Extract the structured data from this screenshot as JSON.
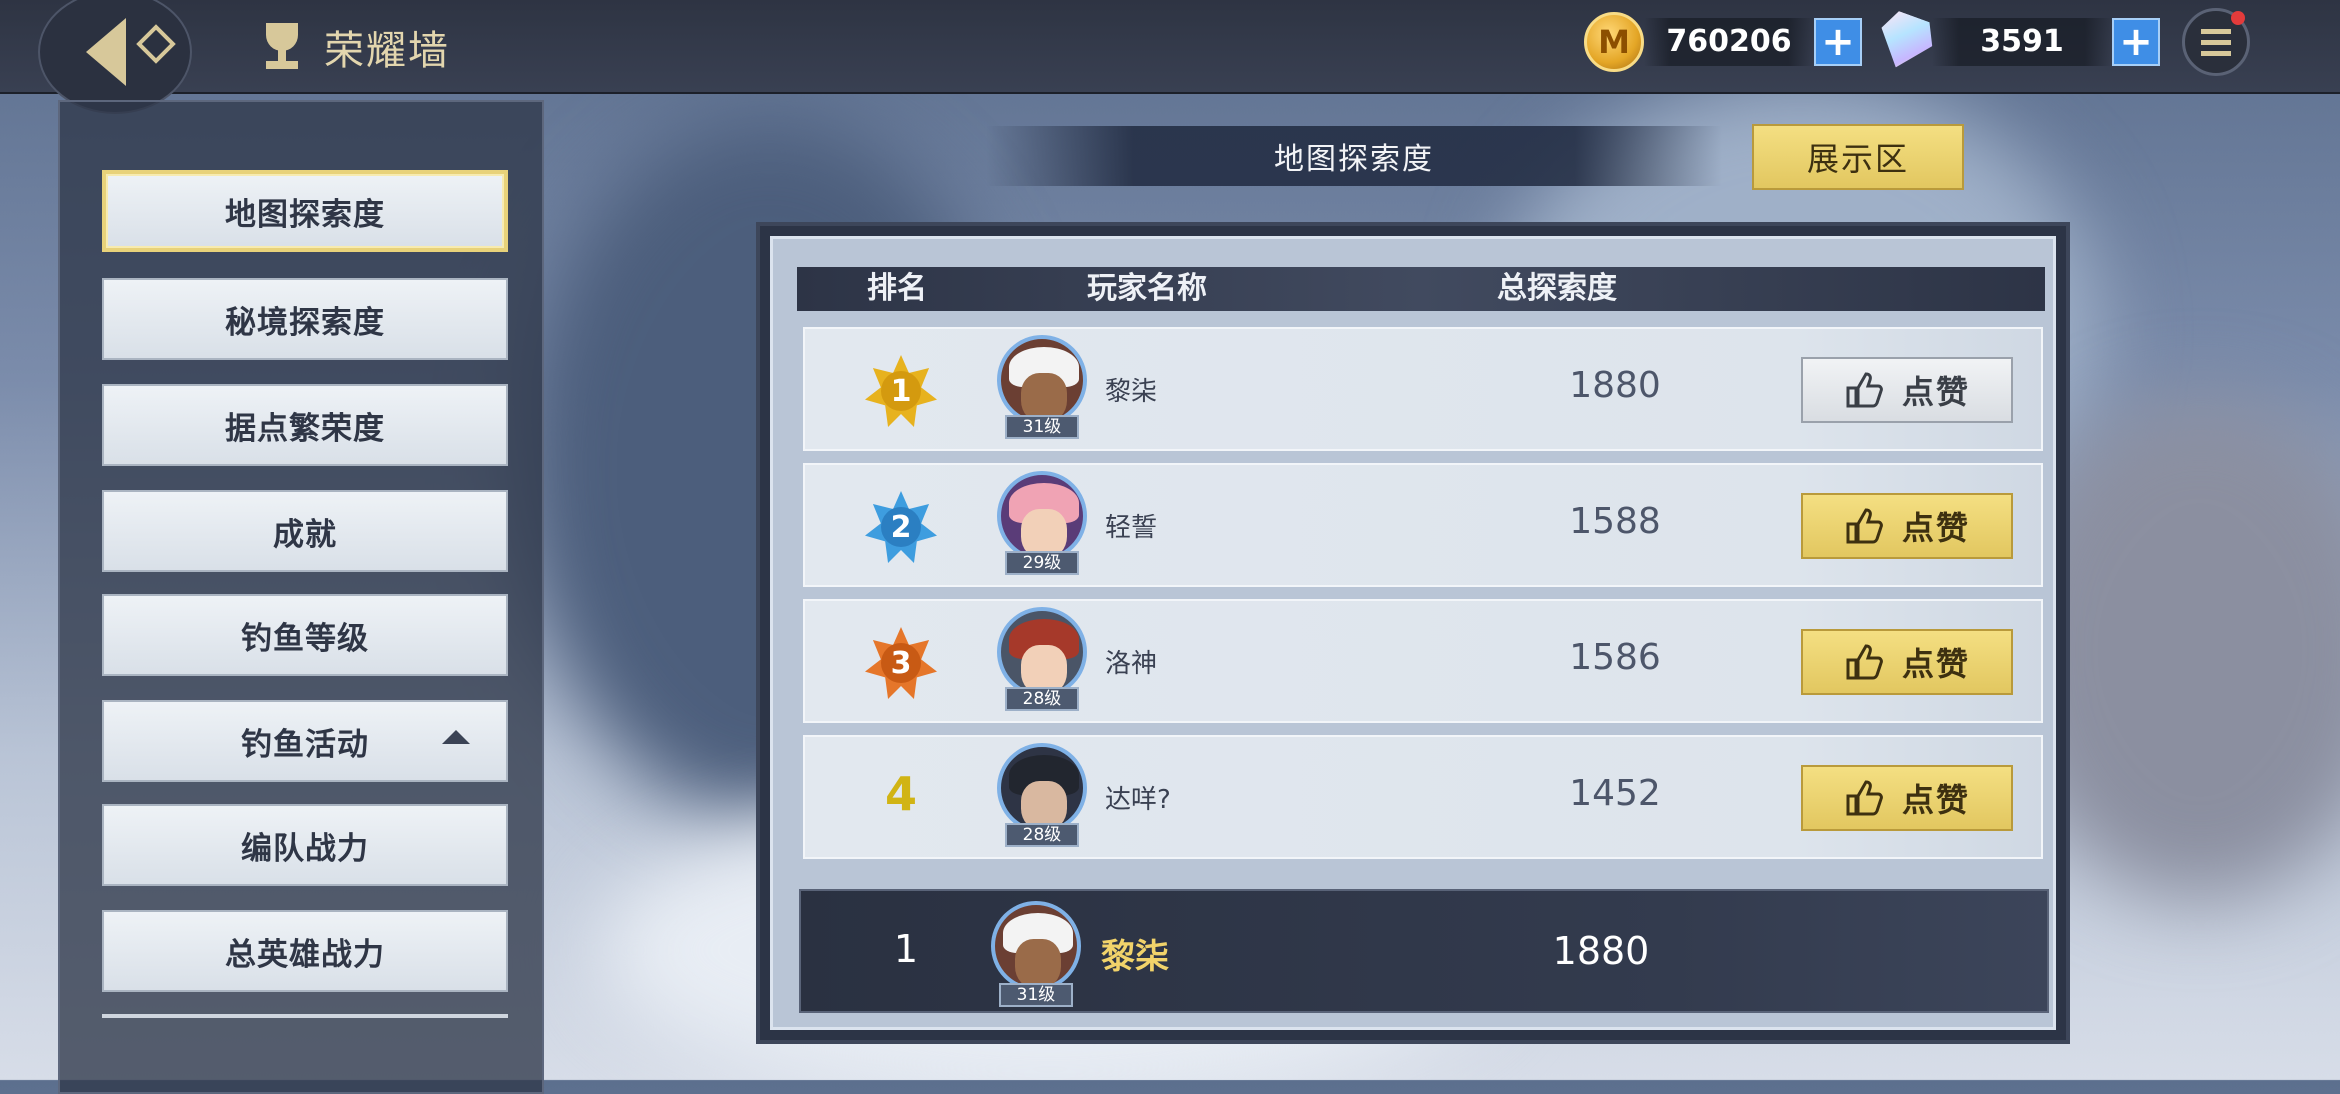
{
  "header": {
    "title": "荣耀墙",
    "gold_value": "760206",
    "gem_value": "3591",
    "gold_icon_letter": "M"
  },
  "sidebar": {
    "items": [
      {
        "label": "地图探索度",
        "active": true
      },
      {
        "label": "秘境探索度"
      },
      {
        "label": "据点繁荣度"
      },
      {
        "label": "成就"
      },
      {
        "label": "钓鱼等级"
      },
      {
        "label": "钓鱼活动",
        "expandable": true
      },
      {
        "label": "编队战力"
      },
      {
        "label": "总英雄战力"
      }
    ]
  },
  "board": {
    "title": "地图探索度",
    "show_button": "展示区",
    "columns": {
      "rank": "排名",
      "name": "玩家名称",
      "score": "总探索度"
    },
    "rows": [
      {
        "rank": "1",
        "name": "黎柒",
        "level": "31级",
        "score": "1880",
        "like": "点赞",
        "liked": true
      },
      {
        "rank": "2",
        "name": "轻誓",
        "level": "29级",
        "score": "1588",
        "like": "点赞",
        "liked": false
      },
      {
        "rank": "3",
        "name": "洛神",
        "level": "28级",
        "score": "1586",
        "like": "点赞",
        "liked": false
      },
      {
        "rank": "4",
        "name": "达咩?",
        "level": "28级",
        "score": "1452",
        "like": "点赞",
        "liked": false
      }
    ],
    "self": {
      "rank": "1",
      "name": "黎柒",
      "level": "31级",
      "score": "1880"
    }
  },
  "colors": {
    "accent_gold": "#e2c760",
    "rank1": "#e7b21e",
    "rank2": "#3e9ddf",
    "rank3": "#e5762a",
    "self_name": "#f1d36a"
  }
}
